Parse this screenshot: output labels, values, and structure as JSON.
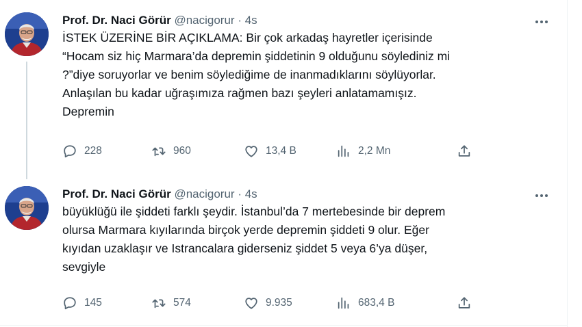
{
  "tweets": [
    {
      "author_name": "Prof. Dr. Naci Görür",
      "handle": "@nacigorur",
      "separator": "·",
      "time": "4s",
      "lines": [
        "İSTEK ÜZERİNE BİR AÇIKLAMA: Bir çok arkadaş hayretler içerisinde",
        "“Hocam siz hiç Marmara’da depremin şiddetinin 9 olduğunu söylediniz mi",
        "?”diye soruyorlar ve benim söylediğime de inanmadıklarını söylüyorlar.",
        "Anlaşılan bu kadar uğraşımıza rağmen bazı şeyleri anlatamamışız.",
        "Depremin"
      ],
      "replies": "228",
      "retweets": "960",
      "likes": "13,4 B",
      "views": "2,2 Mn"
    },
    {
      "author_name": "Prof. Dr. Naci Görür",
      "handle": "@nacigorur",
      "separator": "·",
      "time": "4s",
      "lines": [
        "büyüklüğü ile şiddeti farklı şeydir. İstanbul’da 7 mertebesinde bir deprem",
        "olursa Marmara kıyılarında birçok yerde depremin şiddeti 9 olur. Eğer",
        "kıyıdan uzaklaşır ve Istrancalara giderseniz şiddet 5 veya 6’ya düşer,",
        "sevgiyle"
      ],
      "replies": "145",
      "retweets": "574",
      "likes": "9.935",
      "views": "683,4 B"
    }
  ],
  "icons": {
    "reply": "reply-icon",
    "retweet": "retweet-icon",
    "like": "heart-icon",
    "views": "views-chart-icon",
    "share": "share-icon",
    "more": "more-options-icon"
  },
  "colors": {
    "text": "#0f1419",
    "secondary": "#536471",
    "thread_line": "#cfd9de",
    "border": "#eff3f4"
  }
}
